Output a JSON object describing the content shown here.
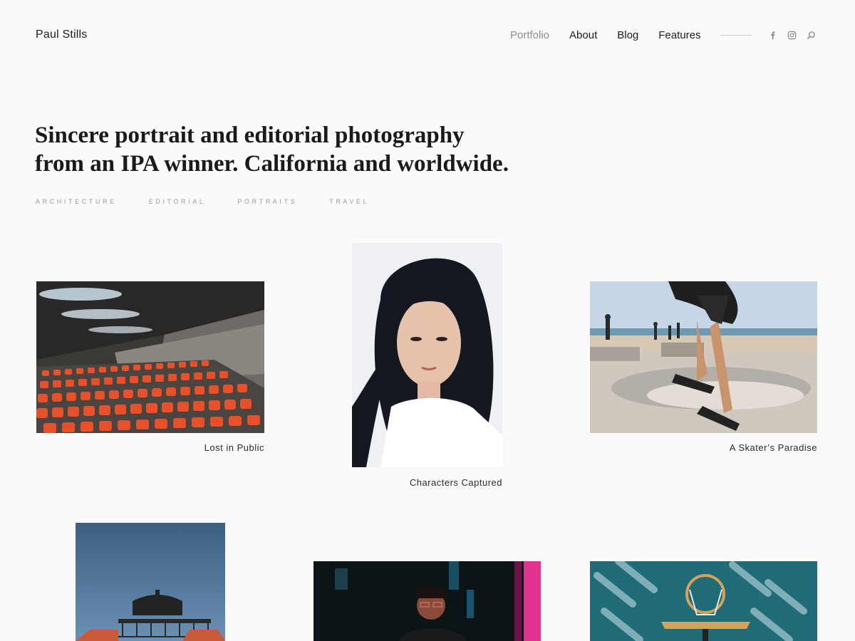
{
  "brand": "Paul Stills",
  "nav": {
    "items": [
      {
        "label": "Portfolio",
        "active": true
      },
      {
        "label": "About",
        "active": false
      },
      {
        "label": "Blog",
        "active": false
      },
      {
        "label": "Features",
        "active": false
      }
    ],
    "icons": [
      "facebook-icon",
      "instagram-icon",
      "search-icon"
    ]
  },
  "hero": {
    "line1": "Sincere portrait and editorial photography",
    "line2": "from an IPA winner. California and worldwide."
  },
  "categories": [
    "ARCHITECTURE",
    "EDITORIAL",
    "PORTRAITS",
    "TRAVEL"
  ],
  "portfolio": [
    {
      "title": "Lost in Public"
    },
    {
      "title": "Characters Captured"
    },
    {
      "title": "A Skater’s Paradise"
    },
    {
      "title": ""
    },
    {
      "title": ""
    },
    {
      "title": ""
    }
  ],
  "colors": {
    "background": "#fafafa",
    "text": "#1c1c1c",
    "muted": "#8d8d8d",
    "seats": "#e8502a",
    "neon": "#e0338f",
    "sky": "#3d5f80"
  }
}
